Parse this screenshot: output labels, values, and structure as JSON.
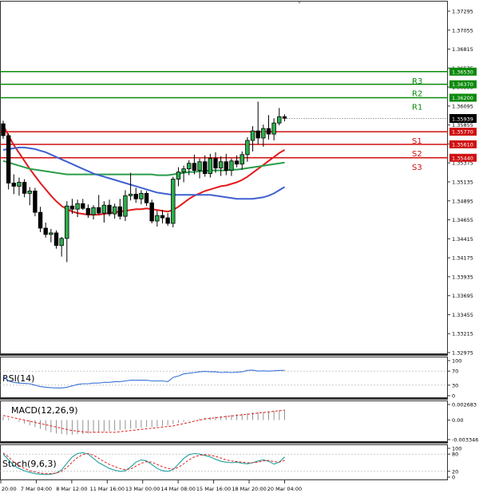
{
  "chart_data": {
    "type": "candlestick",
    "symbol_caption": "",
    "price_axis": {
      "labels": [
        "1.37295",
        "1.37055",
        "1.36815",
        "1.36575",
        "1.36335",
        "1.36095",
        "1.35855",
        "1.35615",
        "1.35375",
        "1.35135",
        "1.34895",
        "1.34655",
        "1.34415",
        "1.34175",
        "1.33935",
        "1.33695",
        "1.33455",
        "1.33215",
        "1.32975"
      ],
      "range": [
        1.32975,
        1.37295
      ],
      "current_price": "1.35939"
    },
    "levels": [
      {
        "label": "R3",
        "value": 1.3653,
        "value_label": "1.36530",
        "color": "#0a8a0a"
      },
      {
        "label": "R2",
        "value": 1.3637,
        "value_label": "1.36370",
        "color": "#0a8a0a"
      },
      {
        "label": "R1",
        "value": 1.362,
        "value_label": "1.36200",
        "color": "#0a8a0a"
      },
      {
        "label": "S1",
        "value": 1.3577,
        "value_label": "1.35770",
        "color": "#d01010"
      },
      {
        "label": "S2",
        "value": 1.3561,
        "value_label": "1.35610",
        "color": "#d01010"
      },
      {
        "label": "S3",
        "value": 1.3544,
        "value_label": "1.35440",
        "color": "#d01010"
      }
    ],
    "time_labels": [
      "6 Mar 20:00",
      "7 Mar 04:00",
      "8 Mar 12:00",
      "11 Mar 16:00",
      "13 Mar 00:00",
      "14 Mar 08:00",
      "15 Mar 16:00",
      "18 Mar 20:00",
      "20 Mar 04:00"
    ],
    "candles": [
      [
        1.3587,
        1.3591,
        1.3568,
        1.3572
      ],
      [
        1.3572,
        1.3575,
        1.3504,
        1.3512
      ],
      [
        1.3512,
        1.3523,
        1.3498,
        1.3508
      ],
      [
        1.3508,
        1.3519,
        1.3496,
        1.3513
      ],
      [
        1.3513,
        1.3517,
        1.3494,
        1.3499
      ],
      [
        1.3499,
        1.3507,
        1.3484,
        1.3502
      ],
      [
        1.3502,
        1.3506,
        1.347,
        1.3475
      ],
      [
        1.3475,
        1.3482,
        1.345,
        1.3455
      ],
      [
        1.3455,
        1.3462,
        1.3443,
        1.3447
      ],
      [
        1.3447,
        1.3454,
        1.3437,
        1.3449
      ],
      [
        1.3449,
        1.3452,
        1.3429,
        1.3433
      ],
      [
        1.3433,
        1.3444,
        1.3419,
        1.3442
      ],
      [
        1.3442,
        1.3489,
        1.3412,
        1.3483
      ],
      [
        1.3483,
        1.3492,
        1.3473,
        1.3479
      ],
      [
        1.3479,
        1.3491,
        1.3469,
        1.3486
      ],
      [
        1.3486,
        1.3492,
        1.3478,
        1.348
      ],
      [
        1.348,
        1.3485,
        1.3468,
        1.3472
      ],
      [
        1.3472,
        1.3484,
        1.3466,
        1.3481
      ],
      [
        1.3481,
        1.3497,
        1.3472,
        1.3474
      ],
      [
        1.3474,
        1.3489,
        1.3462,
        1.3484
      ],
      [
        1.3484,
        1.3491,
        1.347,
        1.3473
      ],
      [
        1.3473,
        1.3486,
        1.3467,
        1.3482
      ],
      [
        1.3482,
        1.3492,
        1.3466,
        1.347
      ],
      [
        1.347,
        1.3503,
        1.3464,
        1.3496
      ],
      [
        1.3496,
        1.3525,
        1.349,
        1.3498
      ],
      [
        1.3498,
        1.3506,
        1.3487,
        1.3492
      ],
      [
        1.3492,
        1.3503,
        1.3485,
        1.3499
      ],
      [
        1.3499,
        1.3502,
        1.3483,
        1.3487
      ],
      [
        1.3487,
        1.3491,
        1.3461,
        1.3464
      ],
      [
        1.3464,
        1.3477,
        1.3457,
        1.3471
      ],
      [
        1.3471,
        1.3478,
        1.3461,
        1.3468
      ],
      [
        1.3468,
        1.3474,
        1.3458,
        1.3461
      ],
      [
        1.3461,
        1.352,
        1.3456,
        1.3517
      ],
      [
        1.3517,
        1.3532,
        1.3508,
        1.3526
      ],
      [
        1.3526,
        1.3534,
        1.3513,
        1.353
      ],
      [
        1.353,
        1.3541,
        1.3522,
        1.3537
      ],
      [
        1.3537,
        1.3548,
        1.3523,
        1.3528
      ],
      [
        1.3528,
        1.3543,
        1.3518,
        1.3539
      ],
      [
        1.3539,
        1.3547,
        1.352,
        1.3524
      ],
      [
        1.3524,
        1.3549,
        1.3519,
        1.3543
      ],
      [
        1.3543,
        1.3551,
        1.3525,
        1.3531
      ],
      [
        1.3531,
        1.3546,
        1.3521,
        1.3539
      ],
      [
        1.3539,
        1.3549,
        1.3522,
        1.3528
      ],
      [
        1.3528,
        1.3543,
        1.3521,
        1.354
      ],
      [
        1.354,
        1.3547,
        1.3532,
        1.3536
      ],
      [
        1.3536,
        1.3552,
        1.3529,
        1.3548
      ],
      [
        1.3548,
        1.357,
        1.3539,
        1.3566
      ],
      [
        1.3566,
        1.3584,
        1.3552,
        1.3578
      ],
      [
        1.3578,
        1.3615,
        1.3561,
        1.3569
      ],
      [
        1.3569,
        1.3586,
        1.3558,
        1.3581
      ],
      [
        1.3581,
        1.3598,
        1.3567,
        1.3574
      ],
      [
        1.3574,
        1.3594,
        1.3566,
        1.3588
      ],
      [
        1.3588,
        1.3607,
        1.3585,
        1.3596
      ],
      [
        1.3596,
        1.3599,
        1.359,
        1.3594
      ]
    ],
    "moving_averages": [
      {
        "color": "#e41a1c",
        "values": [
          1.3585,
          1.3572,
          1.356,
          1.355,
          1.354,
          1.353,
          1.3521,
          1.3512,
          1.3504,
          1.3496,
          1.3489,
          1.3483,
          1.3479,
          1.3476,
          1.3474,
          1.3473,
          1.3472,
          1.3472,
          1.3472,
          1.3473,
          1.3474,
          1.3475,
          1.3476,
          1.3477,
          1.3478,
          1.3479,
          1.3479,
          1.348,
          1.3479,
          1.3478,
          1.3477,
          1.3476,
          1.3478,
          1.3482,
          1.3487,
          1.3492,
          1.3496,
          1.3499,
          1.3502,
          1.3504,
          1.3506,
          1.3508,
          1.3509,
          1.3511,
          1.3513,
          1.3516,
          1.352,
          1.3525,
          1.353,
          1.3535,
          1.354,
          1.3545,
          1.355,
          1.3554
        ]
      },
      {
        "color": "#2a9d4a",
        "values": [
          1.354,
          1.3538,
          1.3536,
          1.3534,
          1.3532,
          1.353,
          1.3529,
          1.3528,
          1.3527,
          1.3526,
          1.3525,
          1.3524,
          1.3523,
          1.3523,
          1.3523,
          1.3523,
          1.3523,
          1.3523,
          1.3523,
          1.3523,
          1.3523,
          1.3523,
          1.3523,
          1.3523,
          1.3523,
          1.3523,
          1.3523,
          1.3523,
          1.3523,
          1.3522,
          1.3522,
          1.3522,
          1.3523,
          1.3524,
          1.3525,
          1.3526,
          1.3526,
          1.3527,
          1.3527,
          1.3528,
          1.3528,
          1.3528,
          1.3528,
          1.3529,
          1.3529,
          1.353,
          1.3531,
          1.3532,
          1.3533,
          1.3534,
          1.3535,
          1.3536,
          1.3537,
          1.3538
        ]
      },
      {
        "color": "#3f60d0",
        "values": [
          1.3554,
          1.3555,
          1.3556,
          1.3557,
          1.3557,
          1.3556,
          1.3555,
          1.3553,
          1.3551,
          1.3548,
          1.3545,
          1.3542,
          1.3539,
          1.3536,
          1.3533,
          1.353,
          1.3527,
          1.3524,
          1.3522,
          1.352,
          1.3518,
          1.3516,
          1.3514,
          1.3512,
          1.351,
          1.3508,
          1.3506,
          1.3504,
          1.3502,
          1.35,
          1.3499,
          1.3498,
          1.3497,
          1.3497,
          1.3497,
          1.3497,
          1.3497,
          1.3497,
          1.3497,
          1.3497,
          1.3496,
          1.3495,
          1.3494,
          1.3493,
          1.3492,
          1.3492,
          1.3492,
          1.3492,
          1.3493,
          1.3494,
          1.3496,
          1.3499,
          1.3503,
          1.3507
        ]
      }
    ],
    "rsi": {
      "label": "RSI(14)",
      "ticks": [
        "100",
        "70",
        "30",
        "0"
      ],
      "range": [
        0,
        100
      ],
      "levels": [
        70,
        30
      ],
      "color": "#3a72d8",
      "values": [
        58,
        42,
        38,
        36,
        35,
        34,
        30,
        26,
        24,
        23,
        22,
        22,
        24,
        28,
        32,
        34,
        34,
        36,
        36,
        38,
        38,
        40,
        40,
        42,
        44,
        44,
        44,
        44,
        42,
        42,
        42,
        40,
        52,
        56,
        62,
        64,
        66,
        68,
        69,
        68,
        68,
        66,
        67,
        66,
        67,
        68,
        72,
        73,
        70,
        71,
        70,
        71,
        72,
        72
      ]
    },
    "macd": {
      "label": "MACD(12,26,9)",
      "ticks": [
        "0.002683",
        "0.00",
        "-0.003346"
      ],
      "range": [
        -0.003346,
        0.002683
      ],
      "hist": [
        0.0006,
        0.0003,
        0.0,
        -0.0003,
        -0.0006,
        -0.0009,
        -0.0012,
        -0.0015,
        -0.0018,
        -0.0021,
        -0.0023,
        -0.0024,
        -0.0025,
        -0.0025,
        -0.0024,
        -0.0024,
        -0.0023,
        -0.0022,
        -0.0021,
        -0.002,
        -0.0019,
        -0.0018,
        -0.0017,
        -0.0016,
        -0.0015,
        -0.0014,
        -0.0013,
        -0.0012,
        -0.0012,
        -0.0011,
        -0.001,
        -0.0009,
        -0.0007,
        -0.0005,
        -0.0003,
        -0.0001,
        0.0001,
        0.0003,
        0.0004,
        0.0005,
        0.0006,
        0.0007,
        0.0008,
        0.0009,
        0.001,
        0.0011,
        0.0012,
        0.0013,
        0.0014,
        0.0014,
        0.0015,
        0.0016,
        0.0017,
        0.0018
      ],
      "signal": [
        0.0008,
        0.0006,
        0.0004,
        0.0002,
        0.0,
        -0.0002,
        -0.0004,
        -0.0006,
        -0.0008,
        -0.001,
        -0.0012,
        -0.0014,
        -0.0016,
        -0.0018,
        -0.0019,
        -0.002,
        -0.0021,
        -0.0021,
        -0.0021,
        -0.0021,
        -0.0021,
        -0.0021,
        -0.002,
        -0.0019,
        -0.0018,
        -0.0017,
        -0.0016,
        -0.0015,
        -0.0014,
        -0.0013,
        -0.0012,
        -0.0011,
        -0.001,
        -0.0008,
        -0.0006,
        -0.0004,
        -0.0002,
        0.0,
        0.0002,
        0.0003,
        0.0004,
        0.0005,
        0.0006,
        0.0007,
        0.0008,
        0.0009,
        0.001,
        0.0011,
        0.0012,
        0.0013,
        0.0014,
        0.0015,
        0.0016,
        0.0017
      ],
      "hist_color": "#909090",
      "signal_color": "#e02020"
    },
    "stoch": {
      "label": "Stoch(9,6,3)",
      "ticks": [
        "100",
        "80",
        "20",
        "0"
      ],
      "range": [
        0,
        100
      ],
      "levels": [
        80,
        20
      ],
      "main_color": "#20a0a0",
      "signal_color": "#e02020",
      "main": [
        80,
        60,
        40,
        30,
        22,
        16,
        12,
        10,
        9,
        10,
        14,
        25,
        48,
        70,
        82,
        85,
        80,
        65,
        50,
        40,
        30,
        24,
        20,
        22,
        35,
        52,
        60,
        56,
        44,
        30,
        22,
        20,
        26,
        45,
        65,
        78,
        82,
        80,
        75,
        70,
        62,
        55,
        52,
        50,
        52,
        48,
        46,
        50,
        56,
        60,
        55,
        45,
        52,
        70
      ],
      "signal": [
        84,
        70,
        52,
        40,
        30,
        22,
        18,
        14,
        12,
        12,
        14,
        20,
        34,
        52,
        68,
        78,
        82,
        76,
        65,
        54,
        44,
        36,
        30,
        26,
        28,
        38,
        48,
        54,
        52,
        44,
        36,
        30,
        28,
        34,
        46,
        60,
        70,
        76,
        78,
        76,
        72,
        66,
        60,
        56,
        54,
        52,
        50,
        50,
        52,
        56,
        58,
        54,
        52,
        58
      ]
    }
  }
}
